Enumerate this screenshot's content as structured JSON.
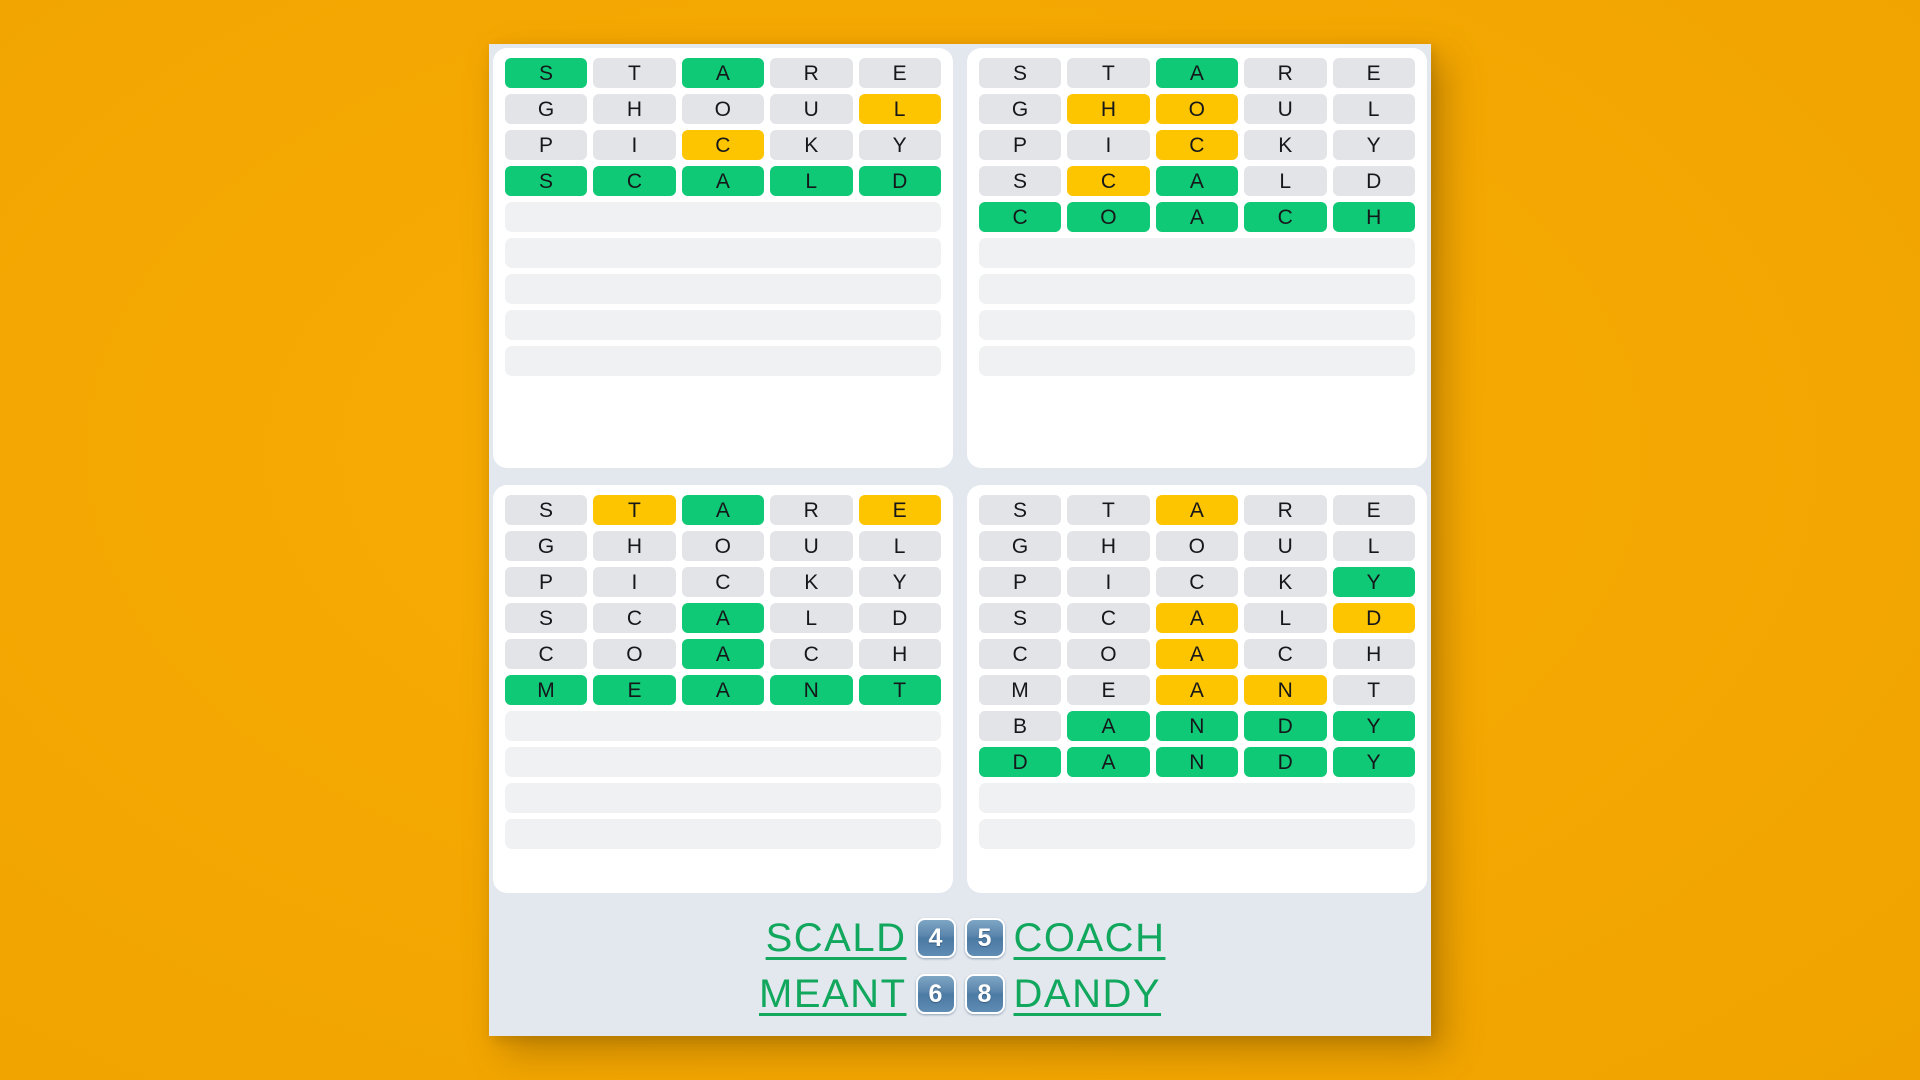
{
  "theme": {
    "background": "#f5a802",
    "panel": "#e3e8ef",
    "card": "#ffffff",
    "correct": "#0fc977",
    "present": "#fdc500",
    "absent": "#e2e4e8",
    "empty_row": "#f0f1f2",
    "word_link": "#11a85e",
    "badge": "#5c87ad"
  },
  "boards": [
    {
      "id": "board-top-left",
      "answer": "SCALD",
      "rows": [
        {
          "letters": [
            "S",
            "T",
            "A",
            "R",
            "E"
          ],
          "states": [
            "correct",
            "absent",
            "correct",
            "absent",
            "absent"
          ]
        },
        {
          "letters": [
            "G",
            "H",
            "O",
            "U",
            "L"
          ],
          "states": [
            "absent",
            "absent",
            "absent",
            "absent",
            "present"
          ]
        },
        {
          "letters": [
            "P",
            "I",
            "C",
            "K",
            "Y"
          ],
          "states": [
            "absent",
            "absent",
            "present",
            "absent",
            "absent"
          ]
        },
        {
          "letters": [
            "S",
            "C",
            "A",
            "L",
            "D"
          ],
          "states": [
            "correct",
            "correct",
            "correct",
            "correct",
            "correct"
          ]
        }
      ],
      "empty_rows": 5
    },
    {
      "id": "board-top-right",
      "answer": "COACH",
      "rows": [
        {
          "letters": [
            "S",
            "T",
            "A",
            "R",
            "E"
          ],
          "states": [
            "absent",
            "absent",
            "correct",
            "absent",
            "absent"
          ]
        },
        {
          "letters": [
            "G",
            "H",
            "O",
            "U",
            "L"
          ],
          "states": [
            "absent",
            "present",
            "present",
            "absent",
            "absent"
          ]
        },
        {
          "letters": [
            "P",
            "I",
            "C",
            "K",
            "Y"
          ],
          "states": [
            "absent",
            "absent",
            "present",
            "absent",
            "absent"
          ]
        },
        {
          "letters": [
            "S",
            "C",
            "A",
            "L",
            "D"
          ],
          "states": [
            "absent",
            "present",
            "correct",
            "absent",
            "absent"
          ]
        },
        {
          "letters": [
            "C",
            "O",
            "A",
            "C",
            "H"
          ],
          "states": [
            "correct",
            "correct",
            "correct",
            "correct",
            "correct"
          ]
        }
      ],
      "empty_rows": 4
    },
    {
      "id": "board-bottom-left",
      "answer": "MEANT",
      "rows": [
        {
          "letters": [
            "S",
            "T",
            "A",
            "R",
            "E"
          ],
          "states": [
            "absent",
            "present",
            "correct",
            "absent",
            "present"
          ]
        },
        {
          "letters": [
            "G",
            "H",
            "O",
            "U",
            "L"
          ],
          "states": [
            "absent",
            "absent",
            "absent",
            "absent",
            "absent"
          ]
        },
        {
          "letters": [
            "P",
            "I",
            "C",
            "K",
            "Y"
          ],
          "states": [
            "absent",
            "absent",
            "absent",
            "absent",
            "absent"
          ]
        },
        {
          "letters": [
            "S",
            "C",
            "A",
            "L",
            "D"
          ],
          "states": [
            "absent",
            "absent",
            "correct",
            "absent",
            "absent"
          ]
        },
        {
          "letters": [
            "C",
            "O",
            "A",
            "C",
            "H"
          ],
          "states": [
            "absent",
            "absent",
            "correct",
            "absent",
            "absent"
          ]
        },
        {
          "letters": [
            "M",
            "E",
            "A",
            "N",
            "T"
          ],
          "states": [
            "correct",
            "correct",
            "correct",
            "correct",
            "correct"
          ]
        }
      ],
      "empty_rows": 4
    },
    {
      "id": "board-bottom-right",
      "answer": "DANDY",
      "rows": [
        {
          "letters": [
            "S",
            "T",
            "A",
            "R",
            "E"
          ],
          "states": [
            "absent",
            "absent",
            "present",
            "absent",
            "absent"
          ]
        },
        {
          "letters": [
            "G",
            "H",
            "O",
            "U",
            "L"
          ],
          "states": [
            "absent",
            "absent",
            "absent",
            "absent",
            "absent"
          ]
        },
        {
          "letters": [
            "P",
            "I",
            "C",
            "K",
            "Y"
          ],
          "states": [
            "absent",
            "absent",
            "absent",
            "absent",
            "correct"
          ]
        },
        {
          "letters": [
            "S",
            "C",
            "A",
            "L",
            "D"
          ],
          "states": [
            "absent",
            "absent",
            "present",
            "absent",
            "present"
          ]
        },
        {
          "letters": [
            "C",
            "O",
            "A",
            "C",
            "H"
          ],
          "states": [
            "absent",
            "absent",
            "present",
            "absent",
            "absent"
          ]
        },
        {
          "letters": [
            "M",
            "E",
            "A",
            "N",
            "T"
          ],
          "states": [
            "absent",
            "absent",
            "present",
            "present",
            "absent"
          ]
        },
        {
          "letters": [
            "B",
            "A",
            "N",
            "D",
            "Y"
          ],
          "states": [
            "absent",
            "correct",
            "correct",
            "correct",
            "correct"
          ]
        },
        {
          "letters": [
            "D",
            "A",
            "N",
            "D",
            "Y"
          ],
          "states": [
            "correct",
            "correct",
            "correct",
            "correct",
            "correct"
          ]
        }
      ],
      "empty_rows": 2
    }
  ],
  "summary": {
    "rows": [
      {
        "left_word": "SCALD",
        "left_count": "4",
        "right_count": "5",
        "right_word": "COACH"
      },
      {
        "left_word": "MEANT",
        "left_count": "6",
        "right_count": "8",
        "right_word": "DANDY"
      }
    ]
  }
}
